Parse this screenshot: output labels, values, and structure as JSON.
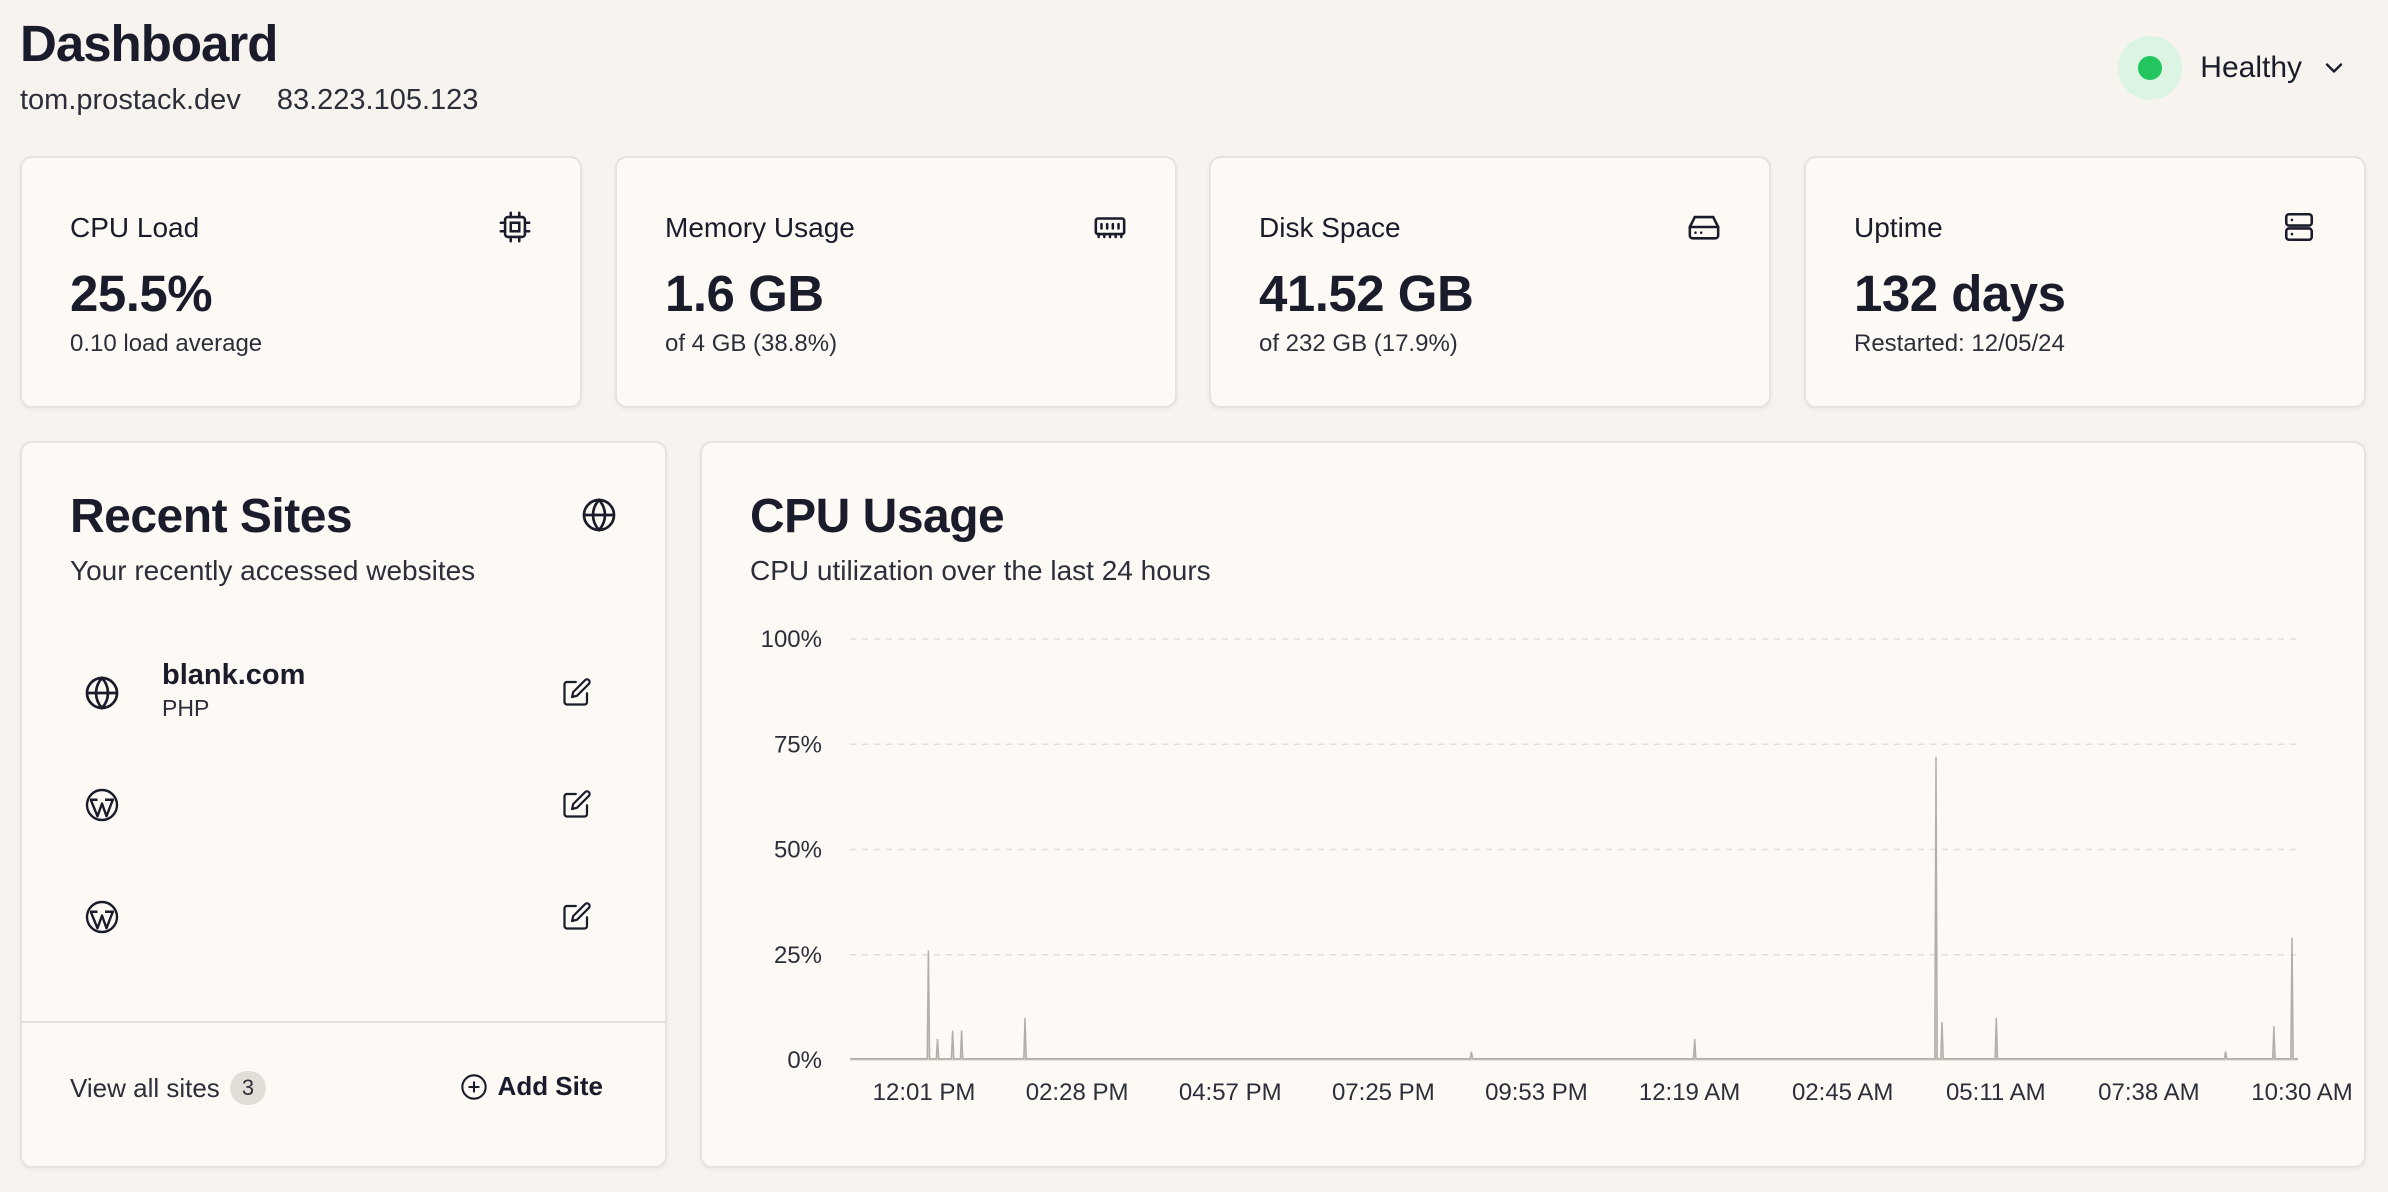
{
  "header": {
    "title": "Dashboard",
    "hostname": "tom.prostack.dev",
    "ip": "83.223.105.123",
    "status": "Healthy"
  },
  "stats": [
    {
      "title": "CPU Load",
      "icon": "cpu-icon",
      "value": "25.5%",
      "sub": "0.10 load average"
    },
    {
      "title": "Memory Usage",
      "icon": "memory-icon",
      "value": "1.6 GB",
      "sub": "of 4 GB (38.8%)"
    },
    {
      "title": "Disk Space",
      "icon": "hard-drive-icon",
      "value": "41.52 GB",
      "sub": "of 232 GB (17.9%)"
    },
    {
      "title": "Uptime",
      "icon": "server-icon",
      "value": "132 days",
      "sub": "Restarted: 12/05/24"
    }
  ],
  "sites": {
    "title": "Recent Sites",
    "description": "Your recently accessed websites",
    "items": [
      {
        "name": "blank.com",
        "lang": "PHP",
        "icon": "globe-icon"
      },
      {
        "name": "",
        "lang": "",
        "icon": "wordpress-icon"
      },
      {
        "name": "",
        "lang": "",
        "icon": "wordpress-icon"
      }
    ],
    "view_all": "View all sites",
    "count": "3",
    "add_label": "Add Site"
  },
  "cpu": {
    "title": "CPU Usage",
    "description": "CPU utilization over the last 24 hours"
  },
  "chart_data": {
    "type": "area",
    "title": "CPU Usage",
    "subtitle": "CPU utilization over the last 24 hours",
    "ylim": [
      0,
      100
    ],
    "yticks": [
      "0%",
      "25%",
      "50%",
      "75%",
      "100%"
    ],
    "xticks": [
      "12:01 PM",
      "02:28 PM",
      "04:57 PM",
      "07:25 PM",
      "09:53 PM",
      "12:19 AM",
      "02:45 AM",
      "05:11 AM",
      "07:38 AM",
      "10:30 AM"
    ],
    "grid": true,
    "x_range_hours": [
      0,
      24
    ],
    "baseline": 0.3,
    "spikes": [
      {
        "t": 1.3,
        "v": 26
      },
      {
        "t": 1.45,
        "v": 5
      },
      {
        "t": 1.7,
        "v": 7
      },
      {
        "t": 1.85,
        "v": 7
      },
      {
        "t": 2.9,
        "v": 10
      },
      {
        "t": 10.3,
        "v": 2
      },
      {
        "t": 14.0,
        "v": 5
      },
      {
        "t": 18.0,
        "v": 72
      },
      {
        "t": 18.1,
        "v": 9
      },
      {
        "t": 19.0,
        "v": 10
      },
      {
        "t": 22.8,
        "v": 2
      },
      {
        "t": 23.6,
        "v": 8
      },
      {
        "t": 23.9,
        "v": 29
      }
    ],
    "colors": {
      "area": "#c8c4bf",
      "line": "#b3aea8",
      "grid": "#e3ded8"
    }
  }
}
